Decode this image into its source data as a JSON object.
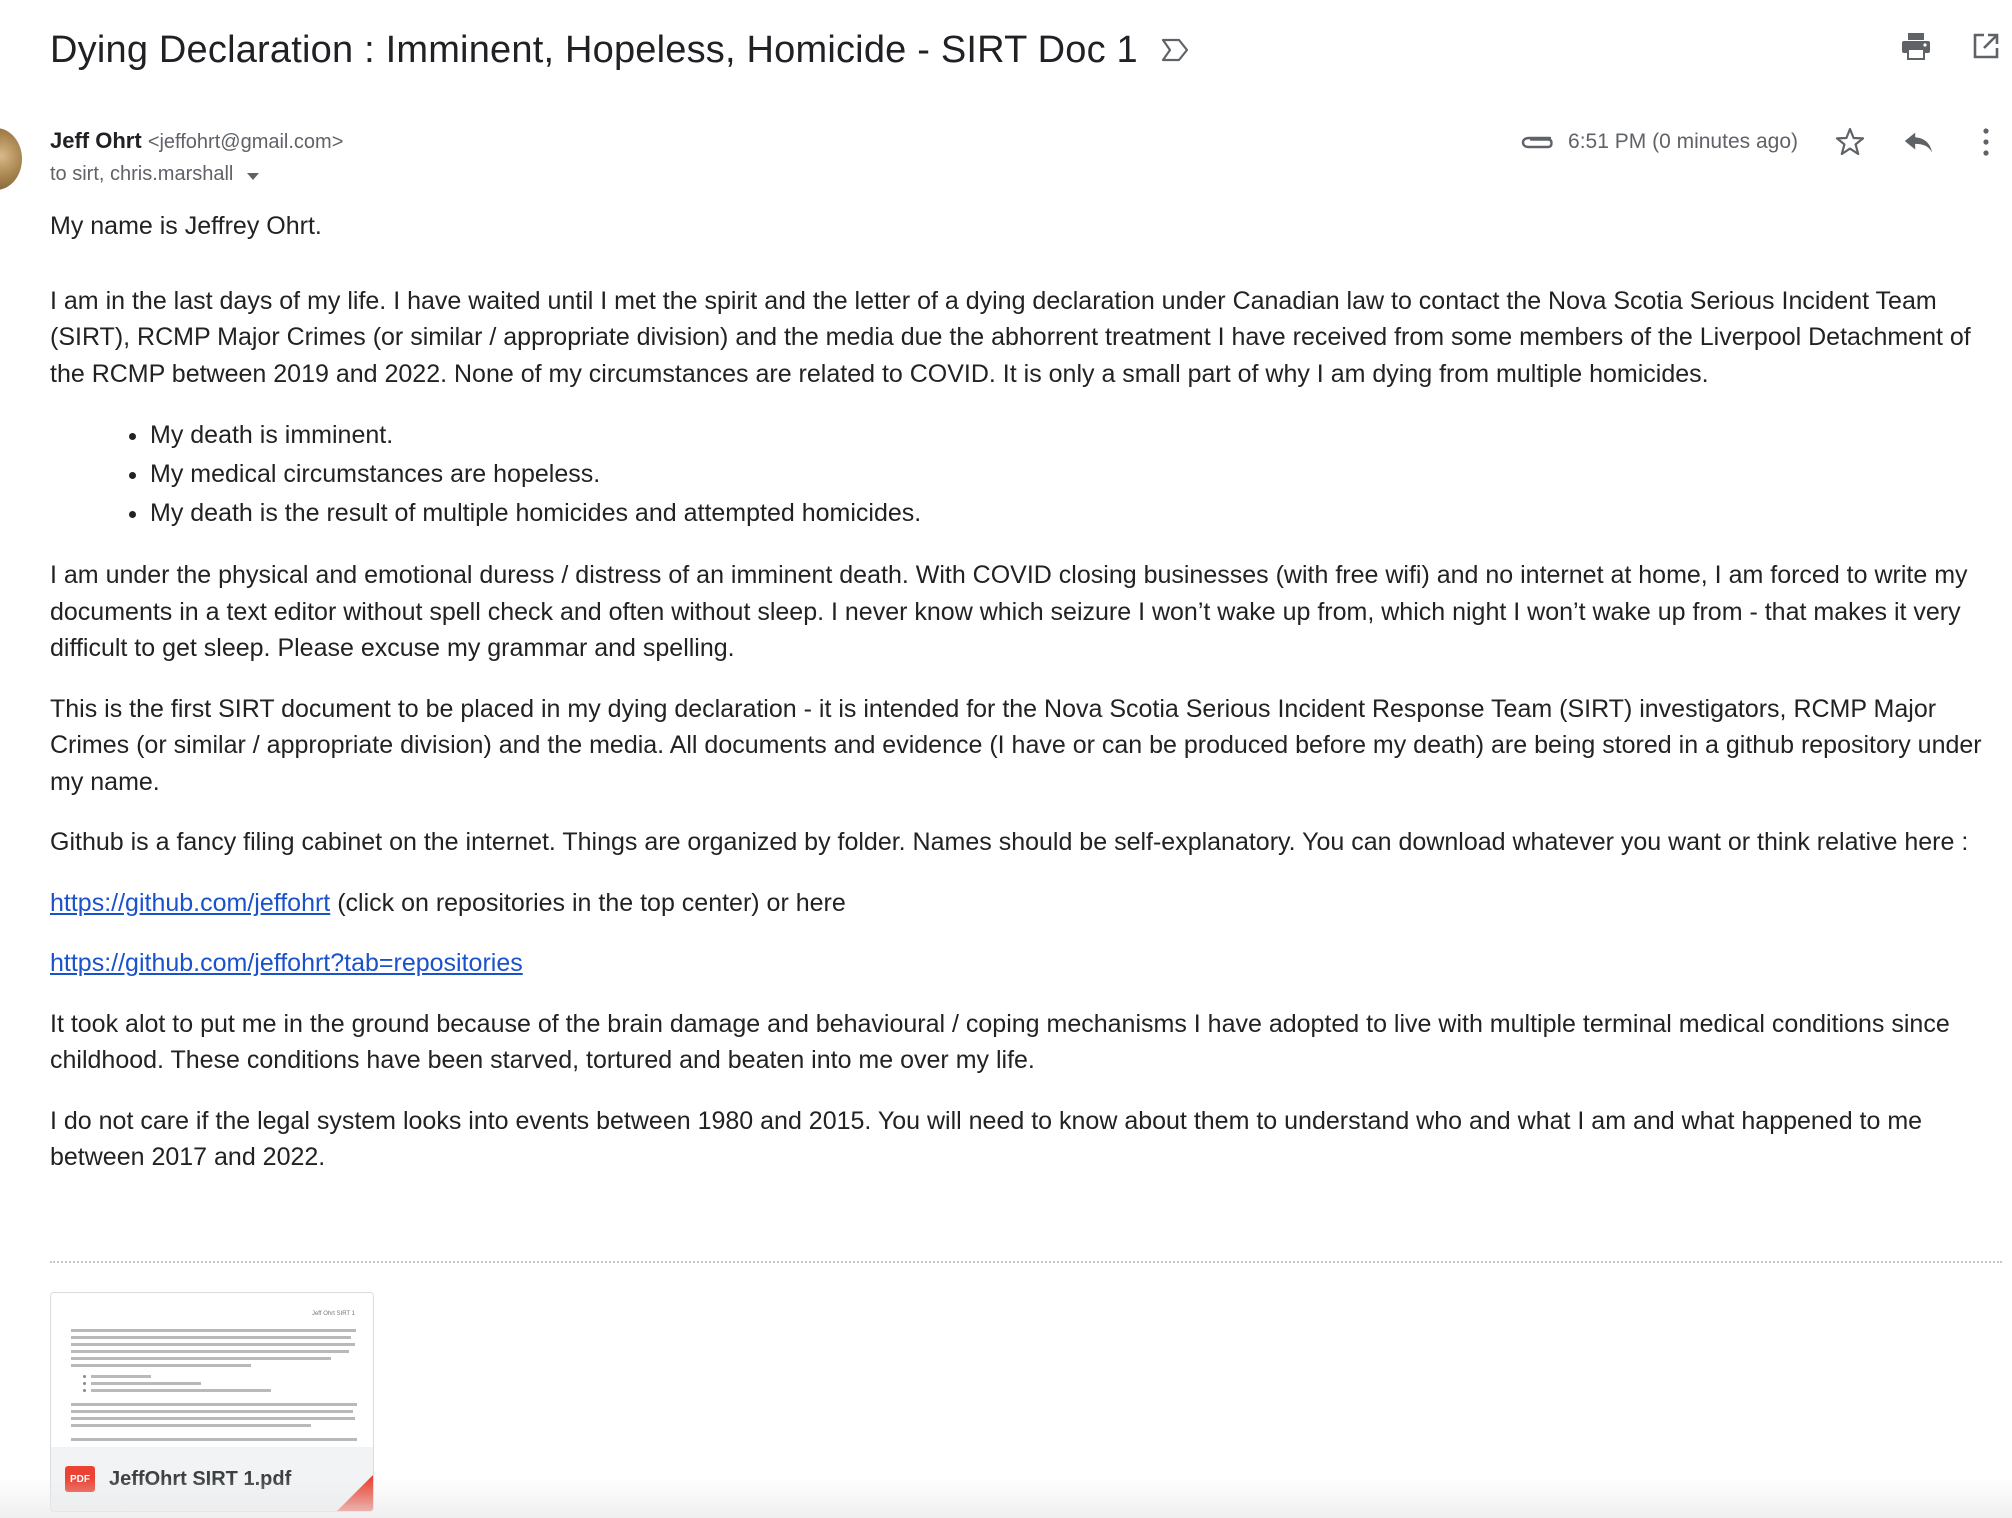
{
  "email": {
    "subject": "Dying Declaration : Imminent, Hopeless, Homicide - SIRT Doc 1",
    "sender_name": "Jeff Ohrt",
    "sender_email": "<jeffohrt@gmail.com>",
    "recipients": "to sirt, chris.marshall",
    "timestamp": "6:51 PM (0 minutes ago)"
  },
  "icons": {
    "label": "label-important-icon",
    "print": "print-icon",
    "open_new_window": "open-in-new-window-icon",
    "attachment": "paperclip-icon",
    "star": "star-icon",
    "reply": "reply-icon",
    "more": "more-vert-icon",
    "pdf": "pdf-icon"
  },
  "body": {
    "p1": "My name is Jeffrey Ohrt.",
    "p2": "I am in the last days of my life.  I have waited until I met the spirit and the letter of a dying declaration under Canadian law to contact the Nova Scotia Serious Incident Team (SIRT), RCMP Major Crimes (or similar / appropriate division) and the media due the abhorrent treatment I have received from some members of the Liverpool Detachment of the RCMP between 2019 and 2022.  None of my circumstances are related to COVID.  It is only a small part of why I am dying from multiple homicides.",
    "bullets": [
      "My death is imminent.",
      "My medical circumstances are hopeless.",
      "My death is the result of multiple homicides and attempted homicides."
    ],
    "p3": "I am under the physical and emotional duress / distress of an imminent death.  With COVID closing businesses (with free wifi) and no internet at home, I am forced to write my documents in a text editor without spell check and often without sleep.  I never know which seizure I won’t wake up from, which night I won’t wake up from - that makes it very difficult to get sleep.  Please excuse my grammar and spelling.",
    "p4": "This is the first SIRT document to be placed in my dying declaration - it is intended for the Nova Scotia Serious Incident Response Team (SIRT) investigators, RCMP Major Crimes (or similar / appropriate division) and the media.  All documents and evidence (I have or can be produced before my death) are being stored in a github repository under my name.",
    "p5": "Github is a fancy filing cabinet on the internet.  Things are organized by folder.  Names should be self-explanatory.  You can download whatever you want or think relative here :",
    "link1": "https://github.com/jeffohrt",
    "link1_suffix": " (click on repositories in the top center) or here",
    "link2": "https://github.com/jeffohrt?tab=repositories",
    "p6": "It took alot to put me in the ground because of the brain damage and behavioural / coping mechanisms I have adopted to live with multiple terminal medical conditions since childhood.  These conditions have been starved, tortured and beaten into me over my life.",
    "p7": "I do not care if the legal system looks into events between 1980 and 2015.  You will need to know about them to understand who and what I am and what happened to me between 2017 and 2022."
  },
  "attachment": {
    "filename": "JeffOhrt SIRT 1.pdf",
    "badge": "PDF",
    "thumb_header": "Jeff Ohrt SIRT 1"
  }
}
